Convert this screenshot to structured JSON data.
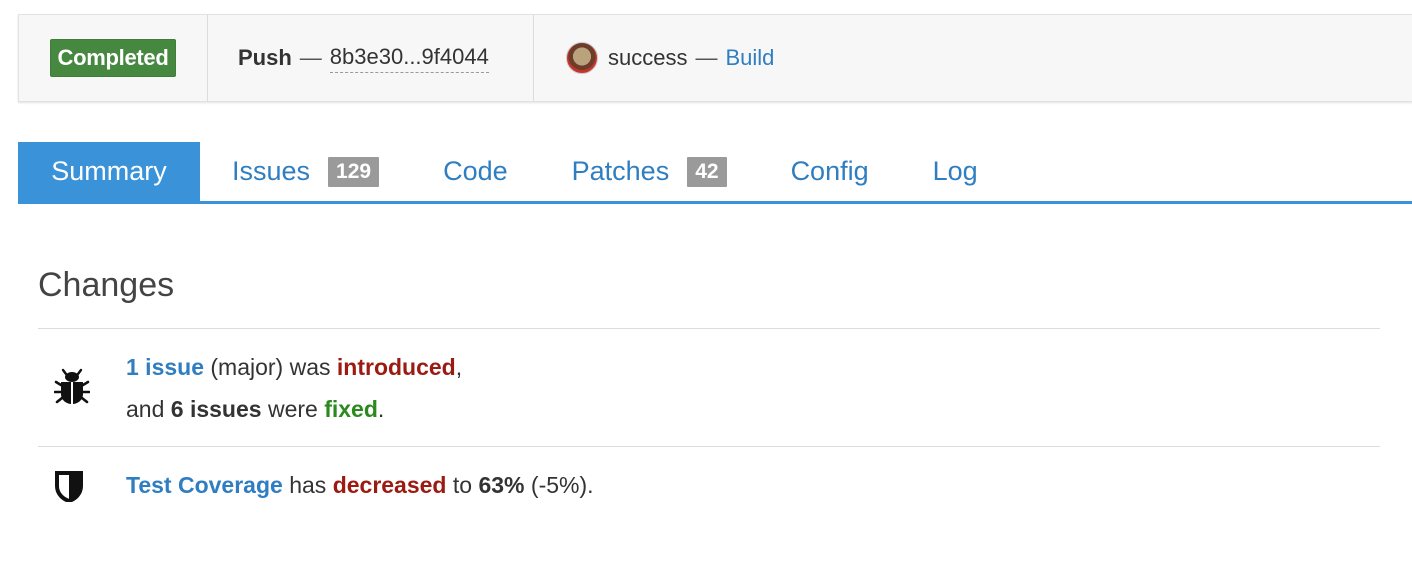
{
  "status": {
    "badge": "Completed",
    "event": "Push",
    "separator": "—",
    "commit": "8b3e30...9f4044",
    "result": "success",
    "build_link": "Build"
  },
  "tabs": [
    {
      "label": "Summary",
      "active": true
    },
    {
      "label": "Issues",
      "count": "129"
    },
    {
      "label": "Code"
    },
    {
      "label": "Patches",
      "count": "42"
    },
    {
      "label": "Config"
    },
    {
      "label": "Log"
    }
  ],
  "changes": {
    "title": "Changes",
    "issues_row": {
      "icon": "bug-icon",
      "introduced_link": "1 issue",
      "severity": "(major) was",
      "introduced_word": "introduced",
      "comma": ",",
      "and": "and",
      "fixed_count": "6 issues",
      "were": "were",
      "fixed_word": "fixed",
      "period": "."
    },
    "coverage_row": {
      "icon": "shield-icon",
      "link": "Test Coverage",
      "has": "has",
      "decreased_word": "decreased",
      "to": "to",
      "percent": "63%",
      "delta": "(-5%)."
    }
  },
  "colors": {
    "completed_green": "#46883f",
    "accent_blue": "#3a92d8",
    "link_blue": "#2f7ec1",
    "introduced_red": "#9b1a12",
    "fixed_green": "#2a8a1e",
    "count_gray": "#9a9a9a"
  }
}
